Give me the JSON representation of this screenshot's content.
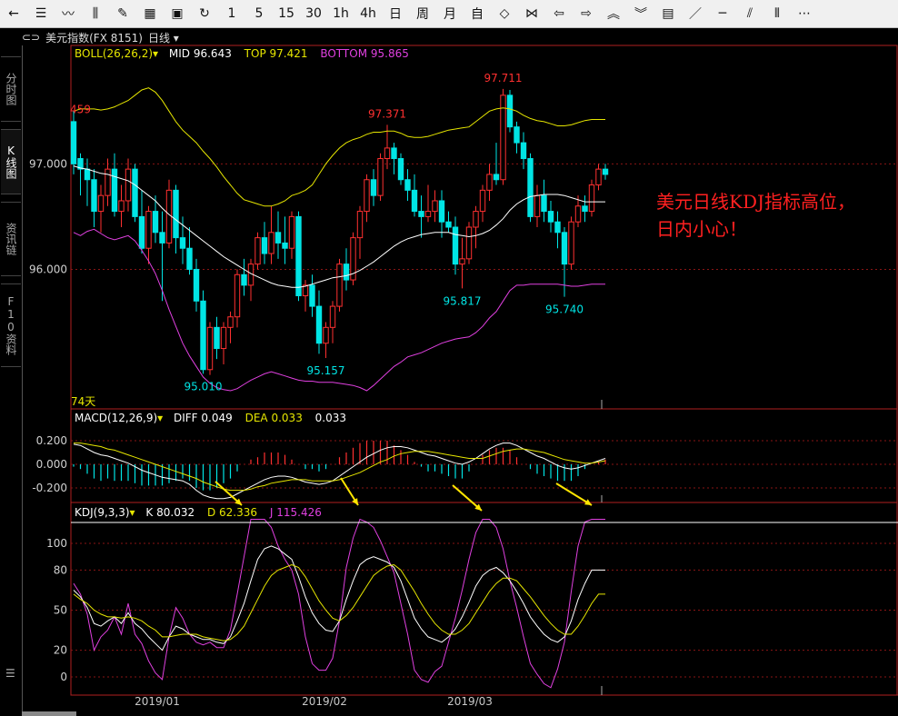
{
  "toolbar": {
    "icons": [
      "back-arrow-icon",
      "list-icon",
      "line-chart-icon",
      "kline-icon",
      "draw-icon",
      "grid-icon",
      "save-icon",
      "refresh-icon"
    ],
    "periods": [
      "1",
      "5",
      "15",
      "30",
      "1h",
      "4h",
      "日",
      "周",
      "月",
      "自"
    ],
    "tool_icons": [
      "expand-icon",
      "shrink-icon",
      "left-arrow-icon",
      "right-arrow-icon",
      "zoom-in-icon",
      "zoom-out-icon",
      "layout-icon",
      "diagonal-line-icon",
      "hline-icon",
      "parallel-line-icon",
      "bars-icon",
      "more-icon"
    ]
  },
  "header": {
    "symbol": "美元指数(FX 8151)",
    "period": "日线"
  },
  "left_tabs": [
    "分时图",
    "K线图",
    "资讯链",
    "F10资料"
  ],
  "annotation": {
    "line1": "美元日线KDJ指标高位，",
    "line2": "日内小心！"
  },
  "colors": {
    "up": "#ff3030",
    "down": "#00e5e5",
    "boll_mid": "#ffffff",
    "boll_top": "#e6e600",
    "boll_bottom": "#e040e0",
    "diff": "#ffffff",
    "dea": "#e6e600",
    "k": "#ffffff",
    "d": "#e6e600",
    "j": "#e040e0",
    "arrow": "#ffe600",
    "annotation": "#ff2020"
  },
  "chart_data": [
    {
      "type": "candlestick",
      "title": "BOLL(26,26,2)",
      "legend": [
        {
          "label": "MID",
          "value": "96.643"
        },
        {
          "label": "TOP",
          "value": "97.421"
        },
        {
          "label": "BOTTOM",
          "value": "95.865"
        }
      ],
      "y_ticks": [
        "97.000",
        "96.000"
      ],
      "ylim": [
        94.85,
        97.95
      ],
      "period_label": "74天",
      "x_ticks": [
        "2019/01",
        "2019/02",
        "2019/03"
      ],
      "ohlc": [
        [
          97.4,
          97.5,
          96.9,
          97.0
        ],
        [
          97.05,
          97.1,
          96.7,
          96.95
        ],
        [
          96.95,
          97.05,
          96.6,
          96.85
        ],
        [
          96.85,
          96.95,
          96.4,
          96.55
        ],
        [
          96.55,
          96.8,
          96.35,
          96.7
        ],
        [
          96.7,
          97.05,
          96.6,
          96.95
        ],
        [
          96.95,
          97.1,
          96.5,
          96.55
        ],
        [
          96.55,
          96.8,
          96.4,
          96.65
        ],
        [
          96.65,
          97.05,
          96.55,
          96.95
        ],
        [
          96.95,
          97.0,
          96.45,
          96.5
        ],
        [
          96.5,
          96.75,
          96.15,
          96.2
        ],
        [
          96.2,
          96.6,
          96.05,
          96.55
        ],
        [
          96.55,
          96.7,
          96.25,
          96.35
        ],
        [
          96.35,
          96.55,
          95.7,
          96.25
        ],
        [
          96.25,
          96.85,
          96.2,
          96.75
        ],
        [
          96.75,
          96.8,
          96.15,
          96.3
        ],
        [
          96.3,
          96.5,
          96.05,
          96.2
        ],
        [
          96.2,
          96.4,
          95.95,
          96.0
        ],
        [
          96.0,
          96.1,
          95.6,
          95.7
        ],
        [
          95.7,
          95.8,
          95.01,
          95.05
        ],
        [
          95.05,
          95.5,
          95.0,
          95.45
        ],
        [
          95.45,
          95.55,
          95.15,
          95.25
        ],
        [
          95.25,
          95.5,
          95.1,
          95.45
        ],
        [
          95.45,
          95.6,
          95.3,
          95.55
        ],
        [
          95.55,
          96.0,
          95.45,
          95.95
        ],
        [
          95.95,
          96.1,
          95.75,
          95.85
        ],
        [
          95.85,
          96.1,
          95.7,
          96.05
        ],
        [
          96.05,
          96.35,
          96.0,
          96.3
        ],
        [
          96.3,
          96.45,
          96.05,
          96.15
        ],
        [
          96.15,
          96.6,
          96.05,
          96.35
        ],
        [
          96.35,
          96.55,
          96.1,
          96.25
        ],
        [
          96.25,
          96.5,
          96.05,
          96.2
        ],
        [
          96.2,
          96.55,
          96.1,
          96.5
        ],
        [
          96.5,
          96.55,
          95.7,
          95.75
        ],
        [
          95.75,
          95.9,
          95.6,
          95.85
        ],
        [
          95.85,
          95.95,
          95.55,
          95.65
        ],
        [
          95.65,
          95.8,
          95.2,
          95.3
        ],
        [
          95.3,
          95.5,
          95.16,
          95.45
        ],
        [
          95.45,
          95.7,
          95.3,
          95.65
        ],
        [
          95.65,
          96.1,
          95.6,
          96.05
        ],
        [
          96.05,
          96.2,
          95.8,
          95.9
        ],
        [
          95.9,
          96.35,
          95.85,
          96.3
        ],
        [
          96.3,
          96.6,
          96.1,
          96.55
        ],
        [
          96.55,
          96.9,
          96.45,
          96.85
        ],
        [
          96.85,
          96.95,
          96.6,
          96.7
        ],
        [
          96.7,
          97.1,
          96.65,
          97.05
        ],
        [
          97.05,
          97.37,
          96.95,
          97.15
        ],
        [
          97.15,
          97.2,
          96.9,
          97.05
        ],
        [
          97.05,
          97.1,
          96.8,
          96.85
        ],
        [
          96.85,
          96.95,
          96.65,
          96.75
        ],
        [
          96.75,
          96.9,
          96.5,
          96.55
        ],
        [
          96.55,
          96.7,
          96.3,
          96.5
        ],
        [
          96.5,
          96.8,
          96.45,
          96.55
        ],
        [
          96.55,
          96.75,
          96.45,
          96.65
        ],
        [
          96.65,
          96.75,
          96.3,
          96.45
        ],
        [
          96.45,
          96.55,
          96.35,
          96.4
        ],
        [
          96.4,
          96.5,
          95.95,
          96.05
        ],
        [
          96.05,
          96.3,
          95.82,
          96.1
        ],
        [
          96.1,
          96.45,
          96.05,
          96.4
        ],
        [
          96.4,
          96.6,
          96.2,
          96.55
        ],
        [
          96.55,
          96.8,
          96.45,
          96.75
        ],
        [
          96.75,
          97.0,
          96.65,
          96.9
        ],
        [
          96.9,
          97.2,
          96.8,
          96.85
        ],
        [
          96.85,
          97.71,
          96.8,
          97.65
        ],
        [
          97.65,
          97.7,
          97.3,
          97.35
        ],
        [
          97.35,
          97.4,
          97.1,
          97.2
        ],
        [
          97.2,
          97.3,
          96.95,
          97.05
        ],
        [
          97.05,
          97.1,
          96.45,
          96.5
        ],
        [
          96.5,
          96.8,
          96.4,
          96.7
        ],
        [
          96.7,
          96.85,
          96.45,
          96.55
        ],
        [
          96.55,
          96.65,
          96.35,
          96.45
        ],
        [
          96.45,
          96.55,
          96.2,
          96.35
        ],
        [
          96.35,
          96.4,
          95.74,
          96.05
        ],
        [
          96.05,
          96.5,
          96.0,
          96.45
        ],
        [
          96.45,
          96.7,
          96.4,
          96.6
        ],
        [
          96.6,
          96.7,
          96.45,
          96.55
        ],
        [
          96.55,
          96.85,
          96.5,
          96.8
        ],
        [
          96.8,
          97.0,
          96.75,
          96.95
        ],
        [
          96.95,
          97.0,
          96.85,
          96.9
        ]
      ],
      "mid": [
        96.98,
        96.96,
        96.95,
        96.93,
        96.91,
        96.9,
        96.88,
        96.86,
        96.84,
        96.8,
        96.75,
        96.7,
        96.65,
        96.58,
        96.52,
        96.47,
        96.42,
        96.37,
        96.32,
        96.27,
        96.22,
        96.17,
        96.12,
        96.08,
        96.04,
        96.0,
        95.96,
        95.93,
        95.9,
        95.87,
        95.85,
        95.84,
        95.83,
        95.83,
        95.84,
        95.86,
        95.88,
        95.9,
        95.92,
        95.93,
        95.94,
        95.96,
        95.99,
        96.03,
        96.07,
        96.12,
        96.17,
        96.22,
        96.26,
        96.29,
        96.31,
        96.33,
        96.34,
        96.35,
        96.35,
        96.35,
        96.33,
        96.32,
        96.31,
        96.32,
        96.34,
        96.37,
        96.42,
        96.48,
        96.56,
        96.62,
        96.66,
        96.69,
        96.7,
        96.71,
        96.71,
        96.71,
        96.7,
        96.68,
        96.66,
        96.64,
        96.64,
        96.64,
        96.64
      ],
      "top": [
        97.5,
        97.52,
        97.52,
        97.52,
        97.51,
        97.52,
        97.54,
        97.57,
        97.6,
        97.65,
        97.7,
        97.72,
        97.68,
        97.6,
        97.5,
        97.4,
        97.32,
        97.26,
        97.2,
        97.12,
        97.05,
        96.97,
        96.88,
        96.8,
        96.72,
        96.66,
        96.64,
        96.62,
        96.6,
        96.6,
        96.62,
        96.65,
        96.7,
        96.72,
        96.75,
        96.8,
        96.9,
        97.0,
        97.08,
        97.15,
        97.2,
        97.23,
        97.25,
        97.28,
        97.3,
        97.3,
        97.31,
        97.31,
        97.29,
        97.26,
        97.25,
        97.25,
        97.26,
        97.28,
        97.3,
        97.32,
        97.33,
        97.34,
        97.35,
        97.4,
        97.45,
        97.5,
        97.52,
        97.53,
        97.52,
        97.5,
        97.46,
        97.43,
        97.41,
        97.4,
        97.38,
        97.36,
        97.36,
        97.37,
        97.39,
        97.41,
        97.42,
        97.42,
        97.42
      ],
      "bottom": [
        96.35,
        96.32,
        96.36,
        96.38,
        96.34,
        96.3,
        96.28,
        96.3,
        96.32,
        96.27,
        96.18,
        96.08,
        95.96,
        95.8,
        95.62,
        95.46,
        95.3,
        95.18,
        95.08,
        94.98,
        94.92,
        94.88,
        94.86,
        94.85,
        94.87,
        94.91,
        94.95,
        94.98,
        95.01,
        95.03,
        95.01,
        94.99,
        94.97,
        94.95,
        94.94,
        94.94,
        94.93,
        94.93,
        94.93,
        94.92,
        94.91,
        94.9,
        94.88,
        94.85,
        94.9,
        94.96,
        95.02,
        95.08,
        95.12,
        95.17,
        95.19,
        95.21,
        95.24,
        95.27,
        95.3,
        95.32,
        95.34,
        95.35,
        95.36,
        95.4,
        95.46,
        95.54,
        95.6,
        95.7,
        95.8,
        95.85,
        95.85,
        95.86,
        95.86,
        95.86,
        95.86,
        95.86,
        95.85,
        95.84,
        95.84,
        95.85,
        95.86,
        95.86,
        95.86
      ],
      "annotations": [
        "95.010",
        "95.157",
        "97.371",
        "95.817",
        "97.711",
        "95.740",
        "459"
      ]
    },
    {
      "type": "macd",
      "title": "MACD(12,26,9)",
      "legend": [
        {
          "label": "DIFF",
          "value": "0.049"
        },
        {
          "label": "DEA",
          "value": "0.033"
        },
        {
          "label": "",
          "value": "0.033"
        }
      ],
      "y_ticks": [
        "0.200",
        "0.000",
        "-0.200"
      ],
      "ylim": [
        -0.33,
        0.33
      ],
      "diff": [
        0.17,
        0.16,
        0.13,
        0.1,
        0.08,
        0.07,
        0.05,
        0.03,
        0.01,
        -0.02,
        -0.05,
        -0.07,
        -0.09,
        -0.11,
        -0.12,
        -0.13,
        -0.14,
        -0.17,
        -0.22,
        -0.26,
        -0.28,
        -0.29,
        -0.29,
        -0.28,
        -0.25,
        -0.22,
        -0.19,
        -0.16,
        -0.13,
        -0.11,
        -0.1,
        -0.1,
        -0.11,
        -0.13,
        -0.15,
        -0.16,
        -0.17,
        -0.16,
        -0.14,
        -0.1,
        -0.06,
        -0.02,
        0.02,
        0.06,
        0.09,
        0.12,
        0.14,
        0.15,
        0.15,
        0.14,
        0.12,
        0.1,
        0.08,
        0.07,
        0.05,
        0.03,
        0.01,
        0.0,
        0.02,
        0.05,
        0.09,
        0.13,
        0.16,
        0.18,
        0.18,
        0.16,
        0.13,
        0.1,
        0.07,
        0.05,
        0.02,
        -0.01,
        -0.03,
        -0.04,
        -0.03,
        -0.01,
        0.01,
        0.03,
        0.05
      ],
      "dea": [
        0.18,
        0.18,
        0.17,
        0.16,
        0.15,
        0.13,
        0.12,
        0.1,
        0.08,
        0.06,
        0.04,
        0.02,
        0.0,
        -0.02,
        -0.04,
        -0.06,
        -0.08,
        -0.1,
        -0.12,
        -0.15,
        -0.17,
        -0.19,
        -0.21,
        -0.22,
        -0.22,
        -0.22,
        -0.21,
        -0.19,
        -0.18,
        -0.16,
        -0.15,
        -0.14,
        -0.13,
        -0.13,
        -0.13,
        -0.14,
        -0.14,
        -0.14,
        -0.14,
        -0.13,
        -0.11,
        -0.09,
        -0.07,
        -0.04,
        -0.01,
        0.02,
        0.04,
        0.07,
        0.09,
        0.1,
        0.11,
        0.11,
        0.11,
        0.1,
        0.09,
        0.08,
        0.07,
        0.06,
        0.05,
        0.05,
        0.05,
        0.07,
        0.09,
        0.11,
        0.12,
        0.13,
        0.13,
        0.12,
        0.11,
        0.1,
        0.08,
        0.06,
        0.04,
        0.03,
        0.02,
        0.01,
        0.01,
        0.02,
        0.03
      ]
    },
    {
      "type": "kdj",
      "title": "KDJ(9,3,3)",
      "legend": [
        {
          "label": "K",
          "value": "80.032"
        },
        {
          "label": "D",
          "value": "62.336"
        },
        {
          "label": "J",
          "value": "115.426"
        }
      ],
      "y_ticks": [
        "100",
        "80",
        "50",
        "20",
        "0"
      ],
      "ylim": [
        -12,
        122
      ],
      "k": [
        65,
        60,
        52,
        40,
        38,
        42,
        45,
        40,
        48,
        40,
        36,
        30,
        25,
        20,
        30,
        38,
        36,
        32,
        30,
        28,
        28,
        26,
        25,
        30,
        42,
        55,
        72,
        88,
        96,
        98,
        96,
        92,
        88,
        75,
        60,
        48,
        40,
        35,
        34,
        42,
        58,
        72,
        84,
        88,
        90,
        88,
        86,
        82,
        72,
        58,
        44,
        36,
        30,
        28,
        26,
        30,
        36,
        45,
        56,
        68,
        76,
        80,
        82,
        78,
        72,
        64,
        55,
        45,
        38,
        32,
        28,
        26,
        30,
        42,
        58,
        70,
        80,
        80,
        80
      ],
      "d": [
        62,
        58,
        55,
        50,
        47,
        45,
        45,
        44,
        45,
        44,
        42,
        38,
        35,
        30,
        30,
        31,
        32,
        32,
        32,
        30,
        29,
        28,
        27,
        28,
        32,
        38,
        48,
        58,
        68,
        76,
        80,
        82,
        84,
        82,
        75,
        66,
        57,
        50,
        44,
        42,
        46,
        52,
        60,
        68,
        76,
        80,
        83,
        84,
        80,
        72,
        64,
        55,
        47,
        40,
        35,
        32,
        32,
        35,
        40,
        48,
        56,
        64,
        70,
        74,
        74,
        72,
        66,
        60,
        53,
        46,
        40,
        35,
        32,
        32,
        38,
        46,
        55,
        62,
        62
      ],
      "j": [
        70,
        62,
        47,
        20,
        30,
        35,
        45,
        32,
        55,
        32,
        25,
        12,
        3,
        -2,
        30,
        52,
        44,
        32,
        26,
        24,
        26,
        22,
        22,
        35,
        62,
        90,
        118,
        120,
        118,
        112,
        98,
        88,
        80,
        62,
        30,
        10,
        5,
        5,
        14,
        42,
        82,
        104,
        120,
        116,
        112,
        102,
        90,
        78,
        55,
        32,
        5,
        -2,
        -4,
        4,
        8,
        26,
        44,
        65,
        88,
        108,
        118,
        118,
        112,
        96,
        72,
        52,
        30,
        10,
        2,
        -5,
        -8,
        6,
        26,
        64,
        98,
        116,
        118,
        118,
        118
      ]
    }
  ]
}
